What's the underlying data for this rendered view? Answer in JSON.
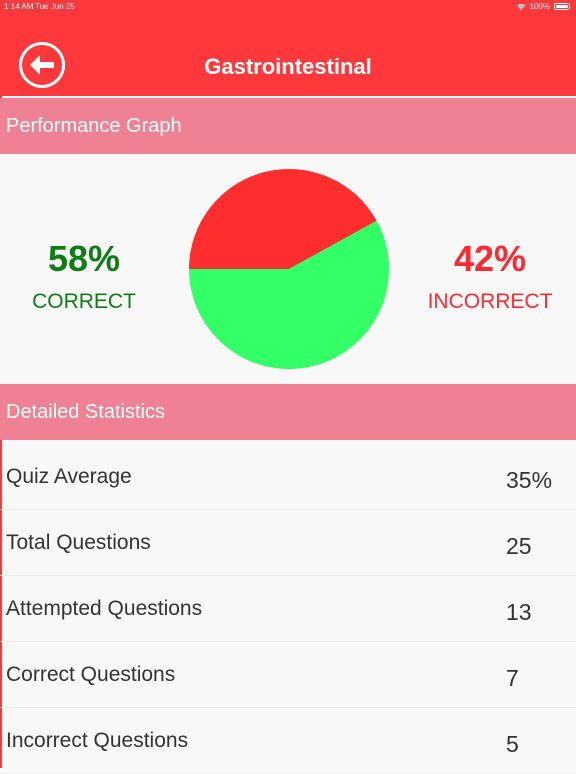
{
  "status_bar": {
    "time": "1:14 AM",
    "date": "Tue Jun 25",
    "battery": "100%"
  },
  "header": {
    "title": "Gastrointestinal"
  },
  "performance": {
    "section_title": "Performance Graph",
    "correct_pct": "58%",
    "correct_label": "CORRECT",
    "incorrect_pct": "42%",
    "incorrect_label": "INCORRECT",
    "colors": {
      "correct": "#33ff66",
      "incorrect": "#ff2e2e"
    }
  },
  "chart_data": {
    "type": "pie",
    "values": [
      58,
      42
    ],
    "colors": [
      "#33ff66",
      "#ff2e2e"
    ]
  },
  "stats": {
    "section_title": "Detailed Statistics",
    "rows": [
      {
        "label": "Quiz Average",
        "value": "35%"
      },
      {
        "label": "Total Questions",
        "value": "25"
      },
      {
        "label": "Attempted Questions",
        "value": "13"
      },
      {
        "label": "Correct Questions",
        "value": "7"
      },
      {
        "label": "Incorrect Questions",
        "value": "5"
      }
    ]
  }
}
